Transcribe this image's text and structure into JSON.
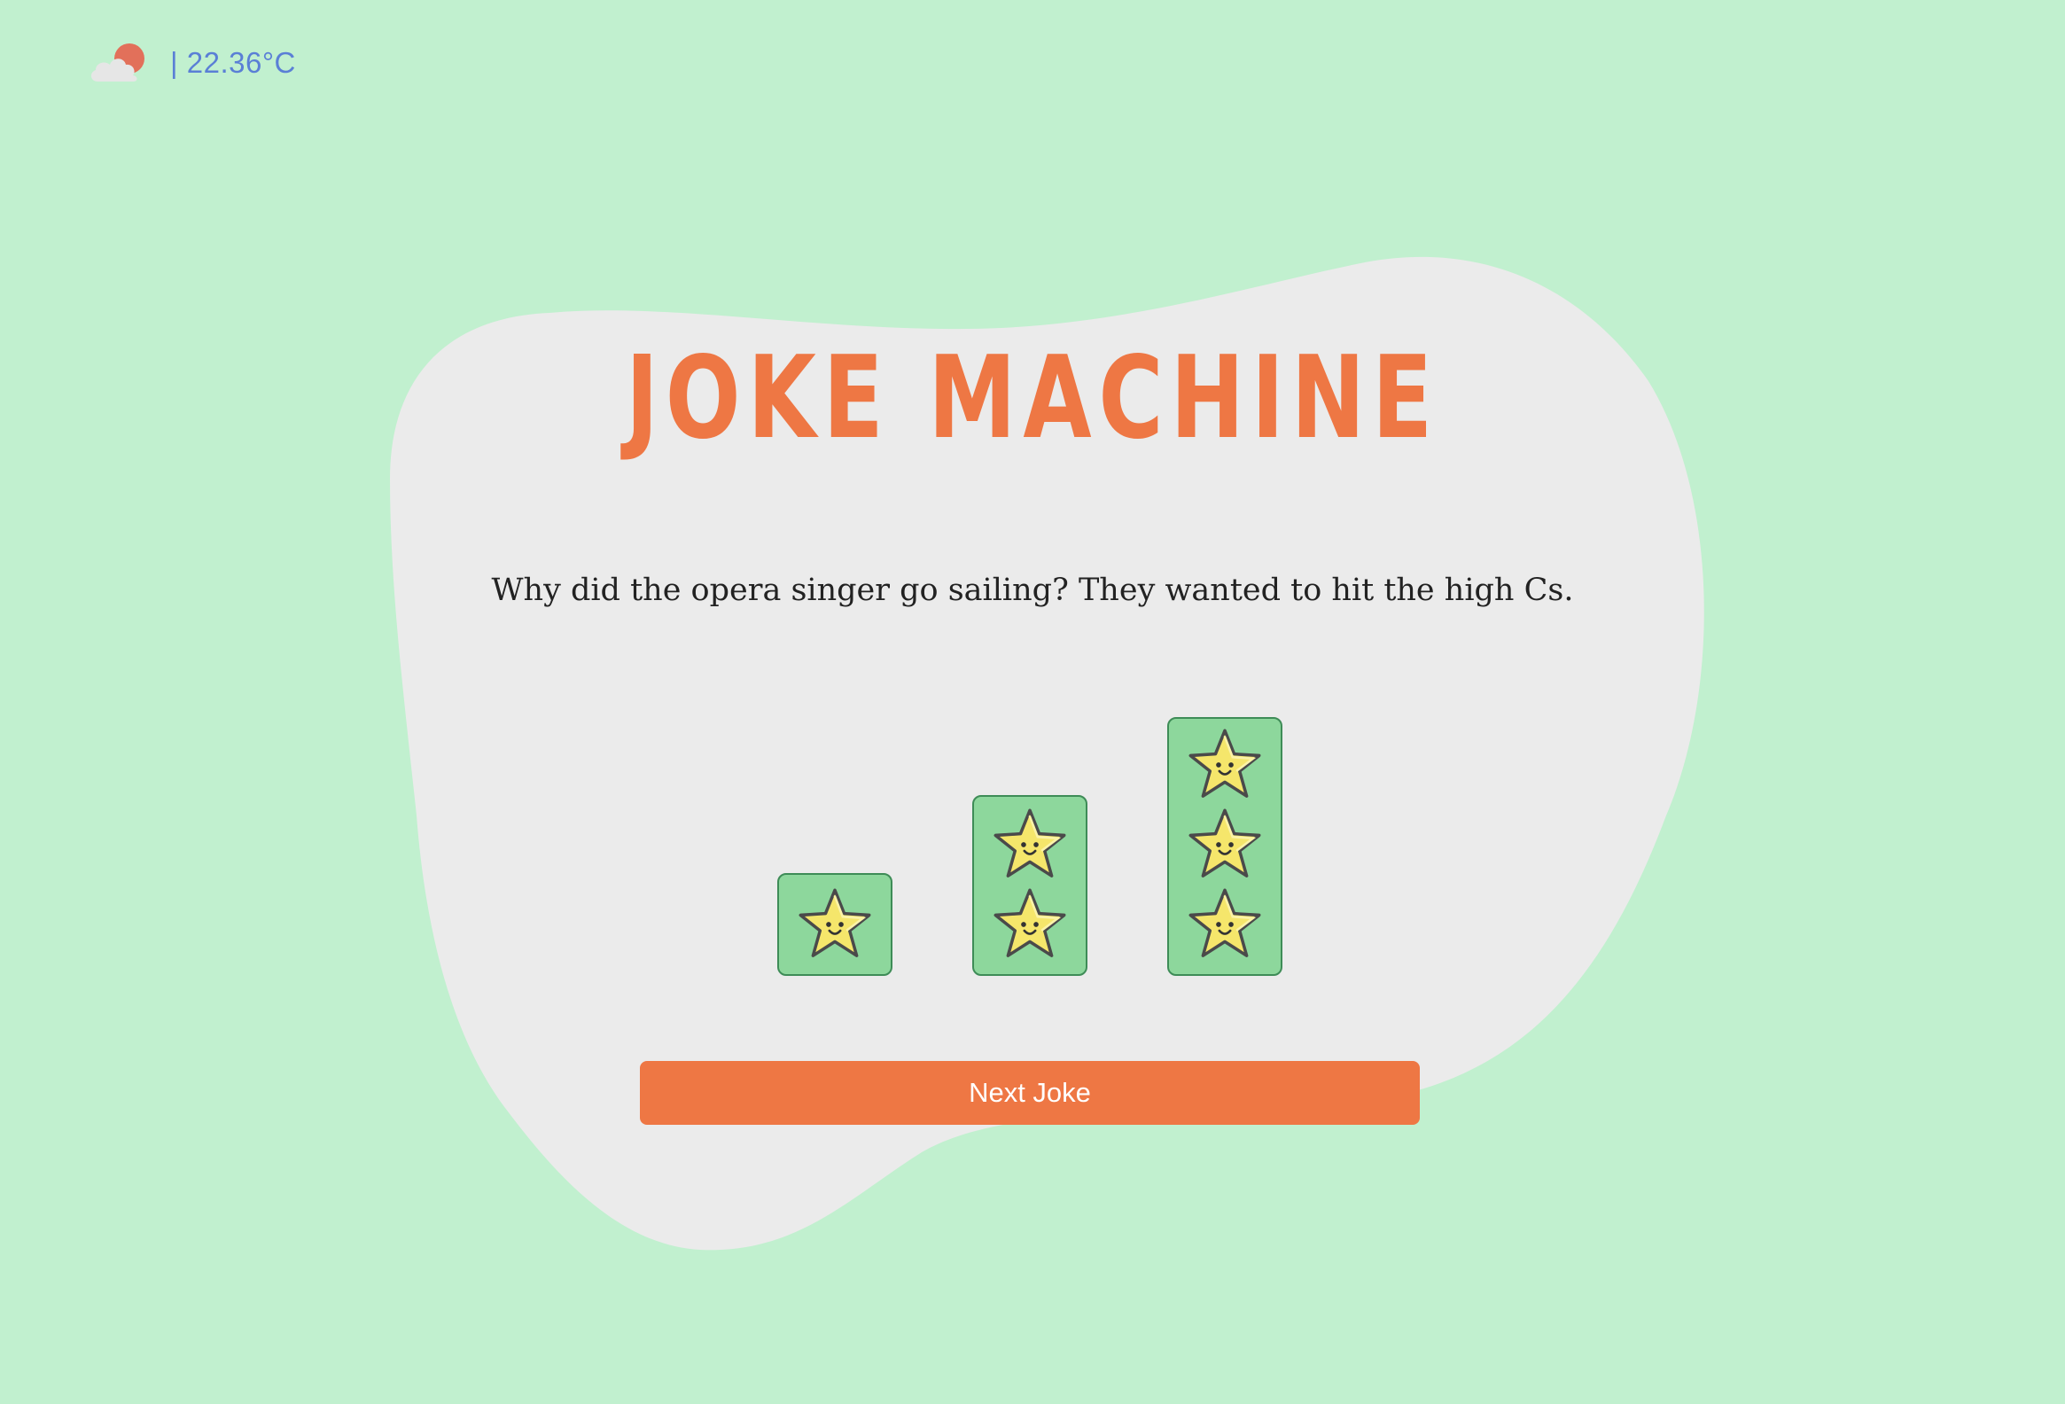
{
  "weather": {
    "icon": "partly-cloudy-sun-icon",
    "temperature": "| 22.36°C"
  },
  "title": "JOKE MACHINE",
  "joke": "Why did the opera singer go sailing? They wanted to hit the high Cs.",
  "ratings": [
    {
      "label": "1-star-rating",
      "stars": 1
    },
    {
      "label": "2-star-rating",
      "stars": 2
    },
    {
      "label": "3-star-rating",
      "stars": 3
    }
  ],
  "next_button": {
    "label": "Next Joke"
  },
  "colors": {
    "background": "#c1f0cf",
    "blob": "#ebebeb",
    "accent": "#ee7744",
    "rating_fill": "#8dd79c",
    "rating_border": "#3e8c57",
    "star": "#f5e66b",
    "temperature": "#5a7fd6"
  }
}
